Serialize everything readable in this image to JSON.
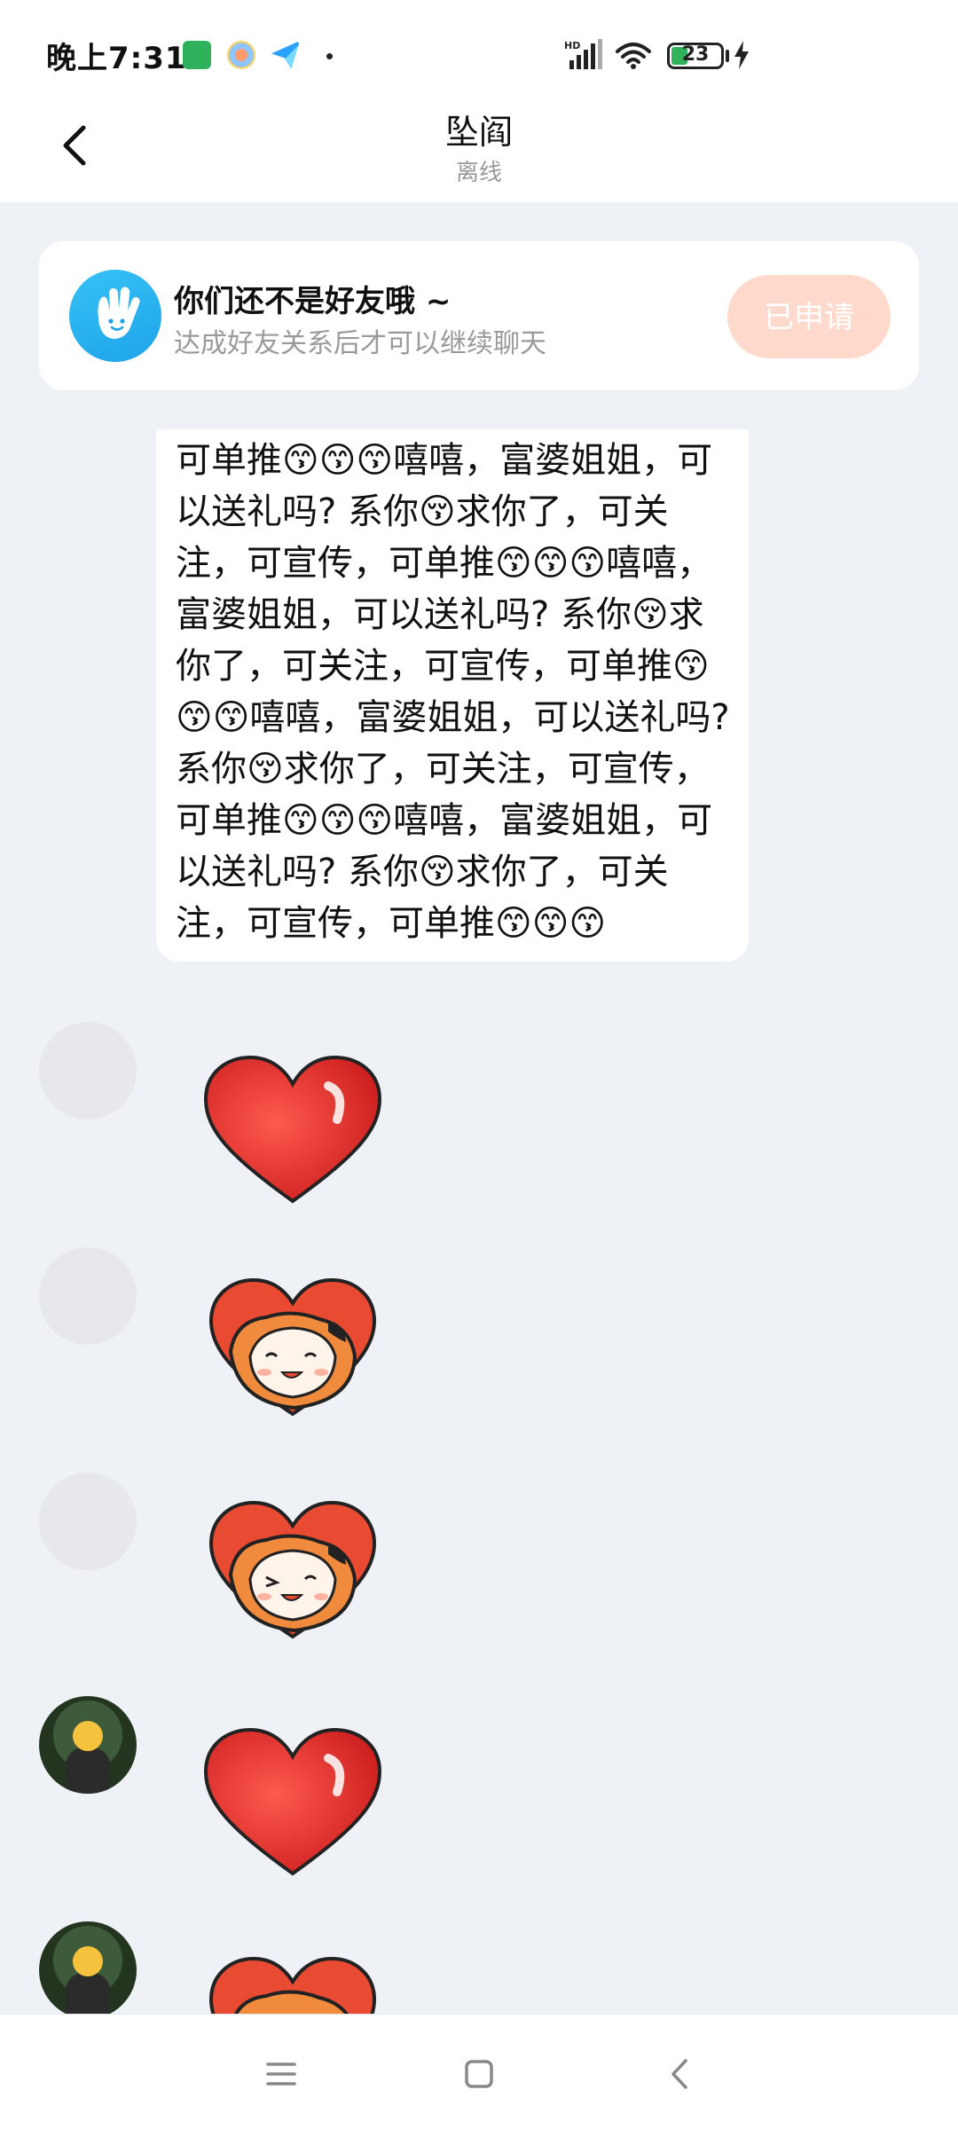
{
  "status_bar": {
    "time": "晚上7:31",
    "battery": "23",
    "network_label": "HD"
  },
  "header": {
    "title": "坠阎",
    "subtitle": "离线"
  },
  "friend_card": {
    "title": "你们还不是好友哦 ~",
    "subtitle": "达成好友关系后才可以继续聊天",
    "button_label": "已申请"
  },
  "messages": {
    "text": "可单推😙😙😙嘻嘻，富婆姐姐，可以送礼吗? 系你😚求你了，可关注，可宣传，可单推😙😙😙嘻嘻，富婆姐姐，可以送礼吗? 系你😚求你了，可关注，可宣传，可单推😙😙😙嘻嘻，富婆姐姐，可以送礼吗? 系你😚求你了，可关注，可宣传，可单推😙😙😙嘻嘻，富婆姐姐，可以送礼吗? 系你😚求你了，可关注，可宣传，可单推😙😙😙",
    "stickers": [
      "heart-sticker",
      "heart-hug-girl-sticker",
      "heart-hug-girl-sticker",
      "heart-sticker",
      "heart-hug-girl-sticker"
    ]
  },
  "colors": {
    "accent": "#1ea3ea",
    "applied_button_bg": "#ffd9cb",
    "page_bg": "#eef1f6",
    "heart_red": "#e8302c"
  },
  "icons": {
    "back": "back-chevron-icon",
    "wave": "wave-hand-icon",
    "nav": [
      "menu-icon",
      "home-icon",
      "back-icon"
    ]
  }
}
